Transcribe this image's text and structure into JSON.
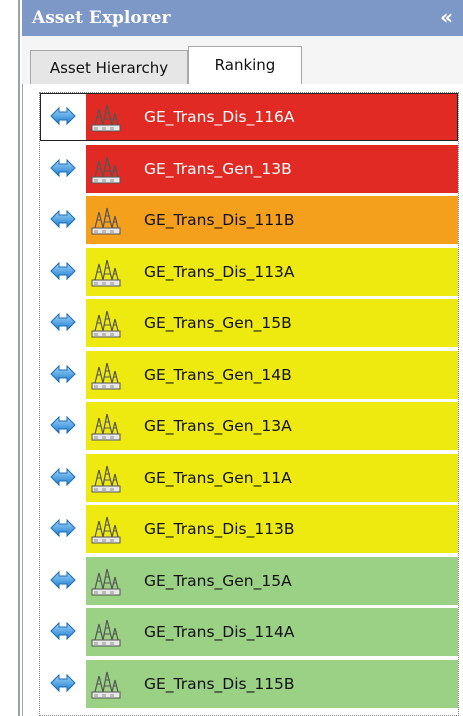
{
  "panel": {
    "title": "Asset Explorer",
    "collapse_label": "«"
  },
  "tabs": [
    {
      "label": "Asset Hierarchy",
      "active": false
    },
    {
      "label": "Ranking",
      "active": true
    }
  ],
  "list": {
    "arrow_icon": "double-arrow-icon",
    "asset_icon": "substation-icon",
    "items": [
      {
        "name": "GE_Trans_Dis_116A",
        "color": "#e12a24",
        "text_color": "#ffffff",
        "selected": true
      },
      {
        "name": "GE_Trans_Gen_13B",
        "color": "#e12a24",
        "text_color": "#ffffff",
        "selected": false
      },
      {
        "name": "GE_Trans_Dis_111B",
        "color": "#f5a01c",
        "text_color": "#111111",
        "selected": false
      },
      {
        "name": "GE_Trans_Dis_113A",
        "color": "#eeea10",
        "text_color": "#111111",
        "selected": false
      },
      {
        "name": "GE_Trans_Gen_15B",
        "color": "#eeea10",
        "text_color": "#111111",
        "selected": false
      },
      {
        "name": "GE_Trans_Gen_14B",
        "color": "#eeea10",
        "text_color": "#111111",
        "selected": false
      },
      {
        "name": "GE_Trans_Gen_13A",
        "color": "#eeea10",
        "text_color": "#111111",
        "selected": false
      },
      {
        "name": "GE_Trans_Gen_11A",
        "color": "#eeea10",
        "text_color": "#111111",
        "selected": false
      },
      {
        "name": "GE_Trans_Dis_113B",
        "color": "#eeea10",
        "text_color": "#111111",
        "selected": false
      },
      {
        "name": "GE_Trans_Gen_15A",
        "color": "#9bd184",
        "text_color": "#111111",
        "selected": false
      },
      {
        "name": "GE_Trans_Dis_114A",
        "color": "#9bd184",
        "text_color": "#111111",
        "selected": false
      },
      {
        "name": "GE_Trans_Dis_115B",
        "color": "#9bd184",
        "text_color": "#111111",
        "selected": false
      }
    ]
  }
}
